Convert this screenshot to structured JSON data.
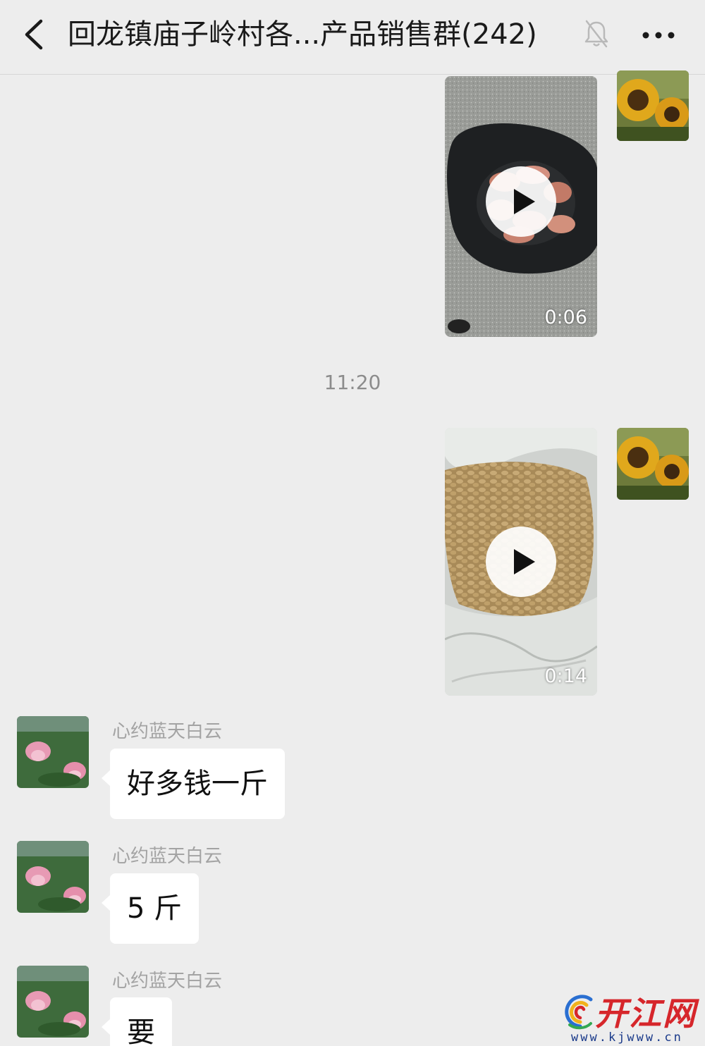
{
  "header": {
    "title": "回龙镇庙子岭村各...产品销售群(242)",
    "back_icon": "chevron-left-icon",
    "mute_icon": "bell-muted-icon",
    "more_icon": "ellipsis-icon"
  },
  "messages": [
    {
      "type": "video",
      "direction": "outgoing",
      "duration": "0:06",
      "content_hint": "sweet potatoes in black bag"
    },
    {
      "type": "time",
      "text": "11:20"
    },
    {
      "type": "video",
      "direction": "outgoing",
      "duration": "0:14",
      "content_hint": "peanuts in white sack"
    },
    {
      "type": "text",
      "direction": "incoming",
      "sender": "心约蓝天白云",
      "text": "好多钱一斤"
    },
    {
      "type": "text",
      "direction": "incoming",
      "sender": "心约蓝天白云",
      "text": "5 斤"
    },
    {
      "type": "text",
      "direction": "incoming",
      "sender": "心约蓝天白云",
      "text": "要"
    }
  ],
  "watermark": {
    "text": "开江网",
    "url": "www.kjwww.cn"
  },
  "colors": {
    "background": "#ededed",
    "bubble_incoming": "#ffffff",
    "watermark_red": "#d6262b"
  }
}
